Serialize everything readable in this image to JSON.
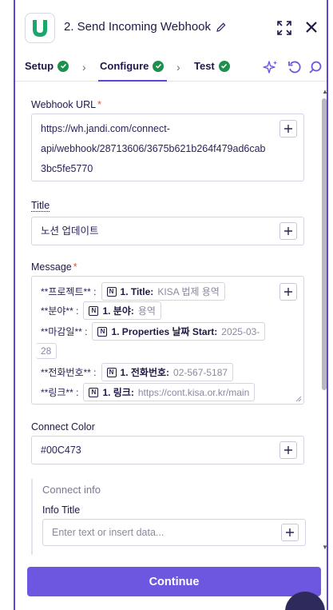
{
  "header": {
    "title": "2. Send Incoming Webhook",
    "app_icon": "jandi-logo",
    "brand_color": "#1aa76b"
  },
  "tabs": [
    {
      "label": "Setup",
      "status": "complete"
    },
    {
      "label": "Configure",
      "status": "complete",
      "active": true
    },
    {
      "label": "Test",
      "status": "complete"
    }
  ],
  "fields": {
    "webhook_url": {
      "label": "Webhook URL",
      "required": true,
      "lines": [
        "https://wh.jandi.com/connect-",
        "api/webhook/28713606/3675b621b264f479ad6cab",
        "3bc5fe5770"
      ]
    },
    "title": {
      "label": "Title",
      "required": false,
      "value": "노션 업데이트"
    },
    "message": {
      "label": "Message",
      "required": true,
      "lines": [
        {
          "prefix": "**프로젝트** :",
          "field": "1. Title:",
          "value": "KISA 법제 용역"
        },
        {
          "prefix": "**분야** :",
          "field": "1. 분야:",
          "value": "용역"
        },
        {
          "prefix": "**마감일** :",
          "field": "1. Properties 날짜 Start:",
          "value": "2025-03-"
        },
        {
          "prefix": "",
          "field": "",
          "value": "28"
        },
        {
          "prefix": "**전화번호** :",
          "field": "1. 전화번호:",
          "value": "02-567-5187"
        },
        {
          "prefix": "**링크** :",
          "field": "1. 링크:",
          "value": "https://cont.kisa.or.kr/main"
        }
      ]
    },
    "connect_color": {
      "label": "Connect Color",
      "value": "#00C473"
    },
    "connect_info": {
      "group_title": "Connect info",
      "info_title_label": "Info Title",
      "info_title_placeholder": "Enter text or insert data..."
    }
  },
  "footer": {
    "continue_label": "Continue"
  },
  "colors": {
    "accent": "#6d56e0",
    "check": "#1f8f4e",
    "required": "#e0533a"
  }
}
